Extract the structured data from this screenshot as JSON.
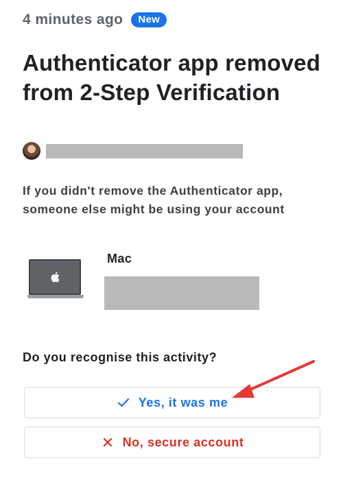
{
  "notification": {
    "timestamp": "4 minutes ago",
    "badge": "New",
    "title": "Authenticator app removed from 2-Step Verification",
    "warning": "If you didn't remove the Authenticator app, someone else might be using your account"
  },
  "device": {
    "name": "Mac",
    "icon": "laptop-icon"
  },
  "prompt": {
    "question": "Do you recognise this activity?",
    "confirm_label": "Yes, it was me",
    "confirm_icon": "checkmark-icon",
    "deny_label": "No, secure account",
    "deny_icon": "close-icon"
  },
  "colors": {
    "accent_blue": "#1a73e8",
    "danger_red": "#d93025",
    "annotation_red": "#e53935",
    "redaction_gray": "#b9b9b9"
  }
}
